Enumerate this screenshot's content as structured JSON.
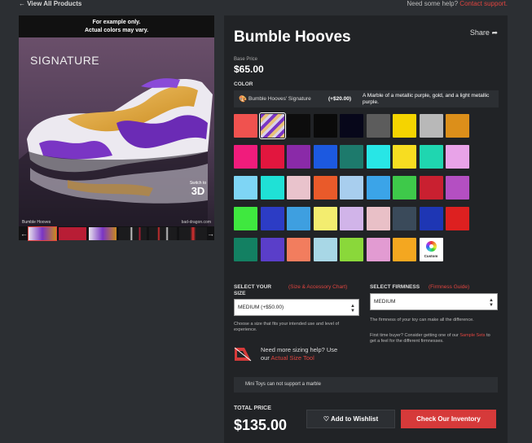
{
  "nav": {
    "back_label": "View All Products",
    "help_prefix": "Need some help?",
    "help_link": "Contact support."
  },
  "gallery": {
    "disclaimer_line1": "For example only.",
    "disclaimer_line2": "Actual colors may vary.",
    "signature_label": "SIGNATURE",
    "caption": "Bumble Hooves",
    "domain": "bad-dragon.com",
    "switch_label": "Switch to",
    "switch_mode": "3D"
  },
  "product": {
    "name": "Bumble Hooves",
    "share_label": "Share",
    "base_price_label": "Base Price",
    "base_price": "$65.00"
  },
  "color": {
    "section_label": "COLOR",
    "selected_name": "Bumble Hooves' Signature",
    "selected_price": "(+$20.00)",
    "selected_desc": "A Marble of a metallic purple, gold, and a light metallic purple.",
    "custom_label": "Custom",
    "swatches": [
      [
        "#f0524f",
        "marble-purple-gold",
        "#0d0d0d",
        "#0a0a0a",
        "#07071a",
        "#5c5c5c",
        "#f5d400",
        "#b8b8b8",
        "#dc8f1a"
      ],
      [
        "#f01c7c",
        "#e2163e",
        "#8a2aa8",
        "#1c59e0",
        "#1d7a6c",
        "#28e6e6",
        "#f7dd21",
        "#1fd6b0",
        "#e8a3e8"
      ],
      [
        "#7ed5f5",
        "#1fe1d6",
        "#e9c3cc",
        "#e95a2a",
        "#a8ceee",
        "#3ba4e8",
        "#3ec94a",
        "#c92030",
        "#b44fc2"
      ],
      [
        "#3fe83f",
        "#2c3cc5",
        "#3e9fe0",
        "#f3ed6f",
        "#d1b4e9",
        "#e9c0c7",
        "#3a4a5a",
        "#1e36b4",
        "#dd2020"
      ],
      [
        "#138062",
        "#5a3ec9",
        "#f27d5e",
        "#a8d7e6",
        "#8ad83a",
        "#e29bd2",
        "#f4a720"
      ]
    ]
  },
  "size": {
    "label": "SELECT YOUR SIZE",
    "guide_link": "(Size & Accessory Chart)",
    "selected": "MEDIUM (+$50.00)",
    "help": "Choose a size that fits your intended use and level of experience."
  },
  "firmness": {
    "label": "SELECT FIRMNESS",
    "guide_link": "(Firmness Guide)",
    "selected": "MEDIUM",
    "help1": "The firmness of your toy can make all the difference.",
    "help2_prefix": "First time buyer? Consider getting one of our ",
    "help2_link": "Sample Sets",
    "help2_suffix": " to get a feel for the different firmnesses."
  },
  "sizing_help": {
    "text_line1": "Need more sizing help? Use",
    "text_prefix": "our ",
    "link": "Actual Size Tool"
  },
  "mini_note": "Mini Toys can not support a marble",
  "checkout": {
    "total_label": "TOTAL PRICE",
    "total_price": "$135.00",
    "wishlist_label": "Add to Wishlist",
    "inventory_label": "Check Our Inventory"
  },
  "colors": {
    "accent": "#e0443f",
    "button_red": "#d63a3a",
    "panel_bg": "#212326",
    "page_bg": "#2c2f33"
  }
}
